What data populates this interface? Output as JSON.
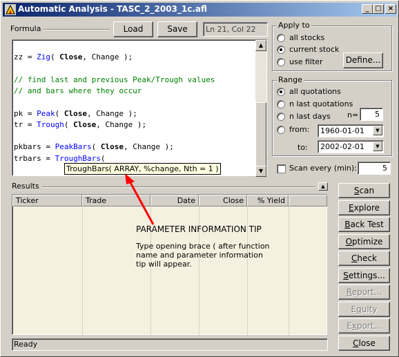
{
  "window": {
    "title": "Automatic Analysis - TASC_2_2003_1c.afl",
    "controls": {
      "minimize": "_",
      "maximize": "□",
      "close": "×"
    }
  },
  "formula": {
    "label": "Formula",
    "load_label": "Load",
    "save_label": "Save",
    "position": "Ln 21, Col 22",
    "code_lines": [
      {
        "segments": [
          {
            "t": "zz = ",
            "c": ""
          },
          {
            "t": "Zig",
            "c": "kw"
          },
          {
            "t": "( ",
            "c": ""
          },
          {
            "t": "Close",
            "c": "bf"
          },
          {
            "t": ", Change );",
            "c": ""
          }
        ]
      },
      {
        "segments": []
      },
      {
        "segments": [
          {
            "t": "// find last and previous Peak/Trough values",
            "c": "cm"
          }
        ]
      },
      {
        "segments": [
          {
            "t": "// and bars where they occur",
            "c": "cm"
          }
        ]
      },
      {
        "segments": []
      },
      {
        "segments": [
          {
            "t": "pk = ",
            "c": ""
          },
          {
            "t": "Peak",
            "c": "kw"
          },
          {
            "t": "( ",
            "c": ""
          },
          {
            "t": "Close",
            "c": "bf"
          },
          {
            "t": ", Change );",
            "c": ""
          }
        ]
      },
      {
        "segments": [
          {
            "t": "tr = ",
            "c": ""
          },
          {
            "t": "Trough",
            "c": "kw"
          },
          {
            "t": "( ",
            "c": ""
          },
          {
            "t": "Close",
            "c": "bf"
          },
          {
            "t": ", Change );",
            "c": ""
          }
        ]
      },
      {
        "segments": []
      },
      {
        "segments": [
          {
            "t": "pkbars = ",
            "c": ""
          },
          {
            "t": "PeakBars",
            "c": "kw"
          },
          {
            "t": "( ",
            "c": ""
          },
          {
            "t": "Close",
            "c": "bf"
          },
          {
            "t": ", Change );",
            "c": ""
          }
        ]
      },
      {
        "segments": [
          {
            "t": "trbars = ",
            "c": ""
          },
          {
            "t": "TroughBars",
            "c": "kw"
          },
          {
            "t": "(",
            "c": ""
          }
        ]
      }
    ],
    "tooltip": "TroughBars( ARRAY, %change, Nth = 1 )"
  },
  "apply_to": {
    "label": "Apply to",
    "options": [
      "all stocks",
      "current stock",
      "use filter"
    ],
    "selected": "current stock",
    "define_label": "Define..."
  },
  "range": {
    "label": "Range",
    "options": [
      "all quotations",
      "n last quotations",
      "n last days",
      "from:"
    ],
    "selected": "all quotations",
    "n_label": "n=",
    "n_value": "5",
    "from_value": "1960-01-01",
    "to_label": "to:",
    "to_value": "2002-02-01"
  },
  "scan_every": {
    "label": "Scan every (min):",
    "value": "5"
  },
  "results": {
    "label": "Results",
    "columns": [
      "Ticker",
      "Trade",
      "Date",
      "Close",
      "% Yield"
    ]
  },
  "annotation": {
    "title": "PARAMETER INFORMATION TIP",
    "body": "Type opening brace ( after function name and parameter information tip will appear.",
    "arrow_color": "#ff0000"
  },
  "buttons": [
    {
      "label": "Scan",
      "enabled": true
    },
    {
      "label": "Explore",
      "enabled": true
    },
    {
      "label": "Back Test",
      "enabled": true
    },
    {
      "label": "Optimize",
      "enabled": true
    },
    {
      "label": "Check",
      "enabled": true
    },
    {
      "label": "Settings...",
      "enabled": true
    },
    {
      "label": "Report...",
      "enabled": false
    },
    {
      "label": "Equity",
      "enabled": false
    },
    {
      "label": "Export...",
      "enabled": false
    },
    {
      "label": "Close",
      "enabled": true
    }
  ],
  "status": "Ready"
}
